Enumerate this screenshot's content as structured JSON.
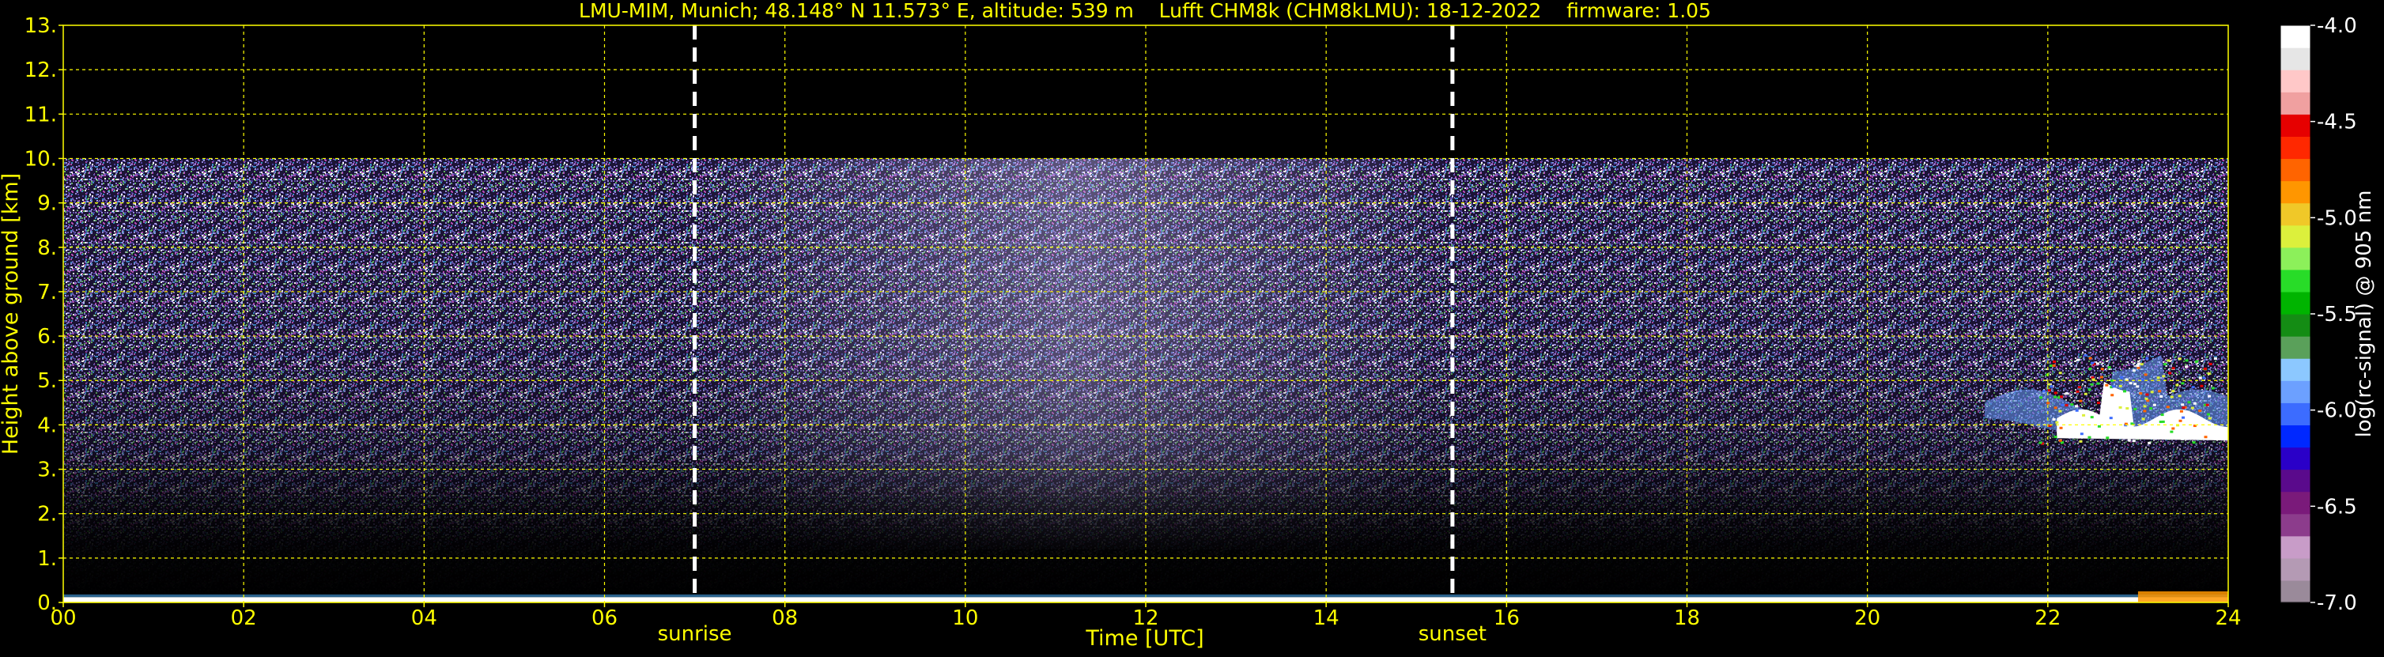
{
  "chart_data": {
    "type": "heatmap",
    "title": "LMU-MIM, Munich; 48.148° N 11.573° E, altitude: 539 m    Lufft CHM8k (CHM8kLMU): 18-12-2022    firmware: 1.05",
    "xlabel": "Time [UTC]",
    "ylabel": "Height above ground [km]",
    "xlim": [
      0,
      24
    ],
    "ylim": [
      0,
      13
    ],
    "x_ticks": [
      "00",
      "02",
      "04",
      "06",
      "08",
      "10",
      "12",
      "14",
      "16",
      "18",
      "20",
      "22",
      "24"
    ],
    "y_ticks": [
      "0.",
      "1.",
      "2.",
      "3.",
      "4.",
      "5.",
      "6.",
      "7.",
      "8.",
      "9.",
      "10.",
      "11.",
      "12.",
      "13."
    ],
    "grid": true,
    "grid_color": "#ffff00",
    "markers": [
      {
        "label": "sunrise",
        "time": 7.0
      },
      {
        "label": "sunset",
        "time": 15.4
      }
    ],
    "noise_top_km": 10.0,
    "cloud_layer": {
      "start": 21.3,
      "end": 24.0,
      "base_km": 3.6,
      "top_km": 5.6
    },
    "colorbar": {
      "label": "log(rc-signal) @ 905 nm",
      "range": [
        -7.0,
        -4.0
      ],
      "ticks": [
        "-4.0",
        "-4.5",
        "-5.0",
        "-5.5",
        "-6.0",
        "-6.5",
        "-7.0"
      ],
      "colors": [
        "#9a8a9a",
        "#b49ab4",
        "#c89cc8",
        "#8c3c8c",
        "#7a1a7a",
        "#5a0a8c",
        "#2a00c8",
        "#0028ff",
        "#3c6cff",
        "#6ca0ff",
        "#8cc8ff",
        "#5aa05a",
        "#148c14",
        "#00b400",
        "#28dc28",
        "#8cf05a",
        "#dcf03c",
        "#f0c828",
        "#ff9600",
        "#ff6400",
        "#ff2800",
        "#e60000",
        "#f0a0a0",
        "#ffc8c8",
        "#e6e6e6",
        "#ffffff"
      ]
    }
  },
  "colors": {
    "background": "#000000",
    "text": "#ffff00",
    "marker": "#ffffff",
    "noise": [
      "#6a5ab4",
      "#8a7ad0",
      "#5040a0",
      "#9a8ae0",
      "#c8c0ff",
      "#ffffff",
      "#3c8cc8",
      "#b44cb4",
      "#64b464"
    ]
  }
}
